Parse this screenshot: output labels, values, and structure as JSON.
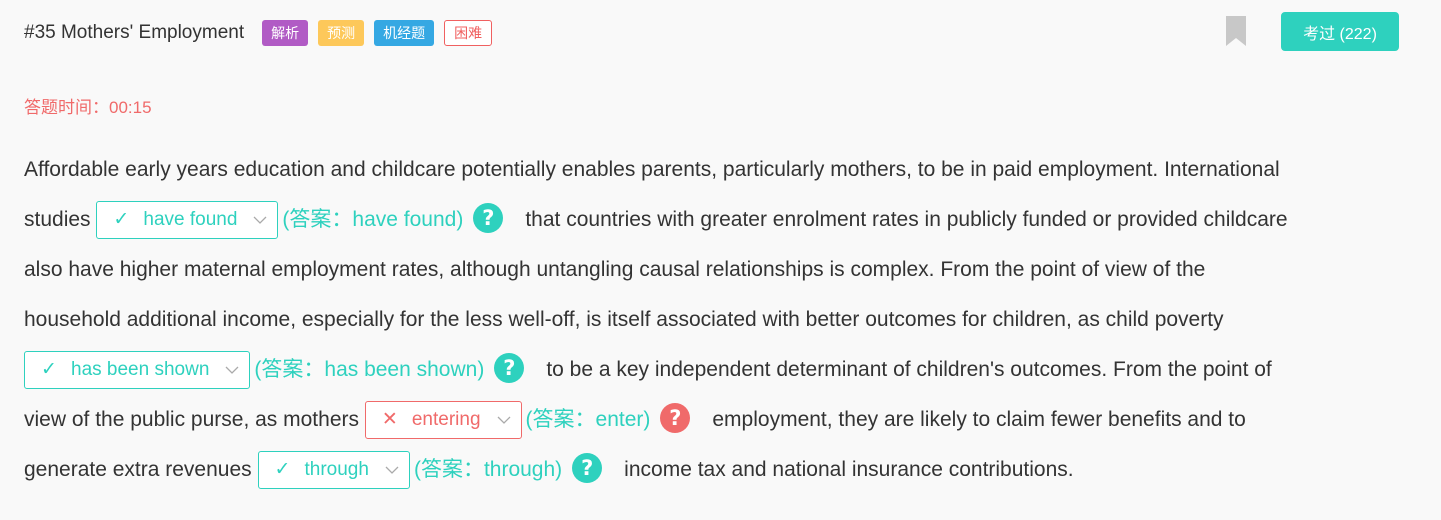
{
  "header": {
    "title": "#35 Mothers' Employment",
    "tags": [
      "解析",
      "预测",
      "机经题",
      "困难"
    ],
    "exam_button": "考过 (222)"
  },
  "timer": "答题时间：00:15",
  "passage": {
    "line1": "Affordable early years education and childcare potentially enables parents, particularly mothers, to be in paid employment. International",
    "line2_pre": "studies",
    "line2_post": "that countries with greater enrolment rates in publicly funded or provided childcare",
    "line3": "also have higher maternal employment rates, although untangling causal relationships is complex. From the point of view of the",
    "line4": "household additional income, especially for the less well-off, is itself associated with better outcomes for children, as child poverty",
    "line5_post": "to be a key independent determinant of children's outcomes. From the point of",
    "line6_pre": "view of the public purse, as mothers",
    "line6_post": "employment, they are likely to claim fewer benefits and to",
    "line7_pre": "generate extra revenues",
    "line7_post": "income tax and national insurance contributions."
  },
  "blanks": [
    {
      "selected": "have found",
      "answer": "(答案：have found)",
      "mark": "✓",
      "status": "correct"
    },
    {
      "selected": "has been shown",
      "answer": "(答案：has been shown)",
      "mark": "✓",
      "status": "correct"
    },
    {
      "selected": "entering",
      "answer": "(答案：enter)",
      "mark": "✕",
      "status": "wrong"
    },
    {
      "selected": "through",
      "answer": "(答案：through)",
      "mark": "✓",
      "status": "correct"
    }
  ],
  "help_icon_glyph": "?",
  "colors": {
    "accent": "#2ed1be",
    "error": "#f06a6a",
    "tag_analysis": "#b15bc5",
    "tag_predict": "#fdc85a",
    "tag_machine": "#35a8e3",
    "bookmark": "#c8c8c8"
  }
}
